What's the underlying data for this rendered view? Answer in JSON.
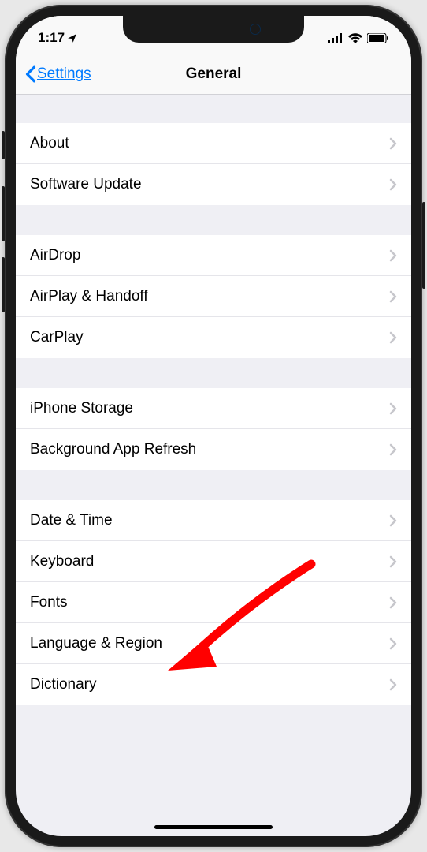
{
  "status": {
    "time": "1:17"
  },
  "nav": {
    "back": "Settings",
    "title": "General"
  },
  "groups": [
    {
      "id": "about-group",
      "items": [
        {
          "id": "about",
          "label": "About"
        },
        {
          "id": "software-update",
          "label": "Software Update"
        }
      ]
    },
    {
      "id": "airdrop-group",
      "items": [
        {
          "id": "airdrop",
          "label": "AirDrop"
        },
        {
          "id": "airplay-handoff",
          "label": "AirPlay & Handoff"
        },
        {
          "id": "carplay",
          "label": "CarPlay"
        }
      ]
    },
    {
      "id": "storage-group",
      "items": [
        {
          "id": "iphone-storage",
          "label": "iPhone Storage"
        },
        {
          "id": "background-app-refresh",
          "label": "Background App Refresh"
        }
      ]
    },
    {
      "id": "datetime-group",
      "items": [
        {
          "id": "date-time",
          "label": "Date & Time"
        },
        {
          "id": "keyboard",
          "label": "Keyboard"
        },
        {
          "id": "fonts",
          "label": "Fonts"
        },
        {
          "id": "language-region",
          "label": "Language & Region"
        },
        {
          "id": "dictionary",
          "label": "Dictionary"
        }
      ]
    }
  ],
  "annotation": {
    "color": "#ff0000",
    "target": "date-time"
  }
}
